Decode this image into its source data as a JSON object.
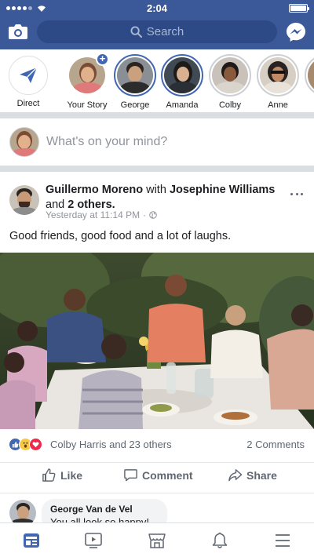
{
  "status_bar": {
    "time": "2:04"
  },
  "top_bar": {
    "search_placeholder": "Search",
    "brand_color": "#3b5998"
  },
  "stories": [
    {
      "label": "Direct",
      "kind": "direct"
    },
    {
      "label": "Your Story",
      "kind": "add"
    },
    {
      "label": "George",
      "kind": "unseen"
    },
    {
      "label": "Amanda",
      "kind": "unseen"
    },
    {
      "label": "Colby",
      "kind": "seen"
    },
    {
      "label": "Anne",
      "kind": "seen"
    }
  ],
  "composer": {
    "placeholder": "What's on your mind?"
  },
  "post": {
    "author": "Guillermo Moreno",
    "with_text": "with",
    "tagged": "Josephine Williams",
    "and_text": "and",
    "others": "2 others.",
    "timestamp": "Yesterday at 11:14 PM",
    "separator": "·",
    "text": "Good friends, good food and a lot of laughs.",
    "reaction_count_text": "Colby Harris and 23 others",
    "comments_text": "2 Comments",
    "actions": {
      "like": "Like",
      "comment": "Comment",
      "share": "Share"
    }
  },
  "comment": {
    "author": "George Van de Vel",
    "text": "You all look so happy!"
  },
  "tabs": [
    "news-feed",
    "watch",
    "marketplace",
    "notifications",
    "menu"
  ]
}
